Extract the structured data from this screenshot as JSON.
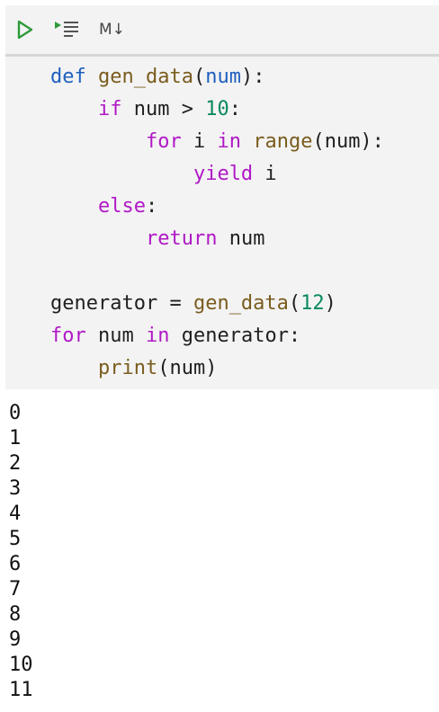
{
  "toolbar": {
    "run_icon": "play-triangle-icon",
    "run_all_icon": "run-all-below-icon",
    "markdown_label": "M↓",
    "colors": {
      "run": "#2e9a3a",
      "icon_gray": "#555555"
    }
  },
  "code": {
    "lines": [
      [
        {
          "t": "def",
          "c": "kw"
        },
        {
          "t": " "
        },
        {
          "t": "gen_data",
          "c": "fn"
        },
        {
          "t": "("
        },
        {
          "t": "num",
          "c": "kw"
        },
        {
          "t": "):"
        }
      ],
      [
        {
          "t": "    "
        },
        {
          "t": "if",
          "c": "ctl"
        },
        {
          "t": " num > "
        },
        {
          "t": "10",
          "c": "num"
        },
        {
          "t": ":"
        }
      ],
      [
        {
          "t": "        "
        },
        {
          "t": "for",
          "c": "ctl"
        },
        {
          "t": " i "
        },
        {
          "t": "in",
          "c": "ctl"
        },
        {
          "t": " "
        },
        {
          "t": "range",
          "c": "fn"
        },
        {
          "t": "(num):"
        }
      ],
      [
        {
          "t": "            "
        },
        {
          "t": "yield",
          "c": "ctl"
        },
        {
          "t": " i"
        }
      ],
      [
        {
          "t": "    "
        },
        {
          "t": "else",
          "c": "ctl"
        },
        {
          "t": ":"
        }
      ],
      [
        {
          "t": "        "
        },
        {
          "t": "return",
          "c": "ctl"
        },
        {
          "t": " num"
        }
      ],
      [],
      [
        {
          "t": "generator = "
        },
        {
          "t": "gen_data",
          "c": "fn"
        },
        {
          "t": "("
        },
        {
          "t": "12",
          "c": "num"
        },
        {
          "t": ")"
        }
      ],
      [
        {
          "t": "for",
          "c": "ctl"
        },
        {
          "t": " num "
        },
        {
          "t": "in",
          "c": "ctl"
        },
        {
          "t": " generator:"
        }
      ],
      [
        {
          "t": "    "
        },
        {
          "t": "print",
          "c": "fn"
        },
        {
          "t": "(num)"
        }
      ]
    ],
    "colors": {
      "keyword": "#1e5fbf",
      "control": "#b018c6",
      "function": "#7a5c1e",
      "number": "#0a8a5e"
    }
  },
  "output": {
    "lines": [
      "0",
      "1",
      "2",
      "3",
      "4",
      "5",
      "6",
      "7",
      "8",
      "9",
      "10",
      "11"
    ]
  }
}
